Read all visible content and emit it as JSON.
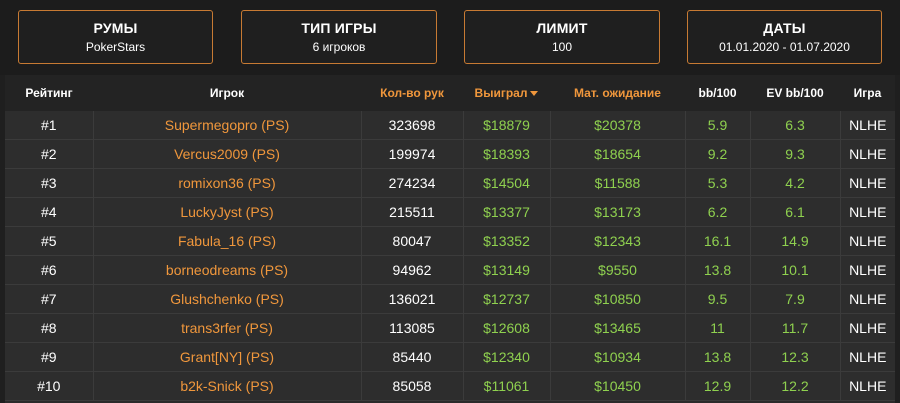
{
  "filters": [
    {
      "title": "РУМЫ",
      "value": "PokerStars"
    },
    {
      "title": "ТИП ИГРЫ",
      "value": "6 игроков"
    },
    {
      "title": "ЛИМИТ",
      "value": "100"
    },
    {
      "title": "ДАТЫ",
      "value": "01.01.2020 - 01.07.2020"
    }
  ],
  "colors": {
    "accent": "#f0973c",
    "positive": "#8fd14f",
    "border": "#c77a33"
  },
  "table": {
    "headers": {
      "rank": "Рейтинг",
      "player": "Игрок",
      "hands": "Кол-во рук",
      "won": "Выиграл",
      "ev": "Мат. ожидание",
      "bb100": "bb/100",
      "evbb100": "EV bb/100",
      "game": "Игра"
    },
    "sort_icon": "caret-down-icon",
    "rows": [
      {
        "rank": "#1",
        "player": "Supermegopro (PS)",
        "hands": "323698",
        "won": "$18879",
        "ev": "$20378",
        "bb100": "5.9",
        "evbb100": "6.3",
        "game": "NLHE"
      },
      {
        "rank": "#2",
        "player": "Vercus2009 (PS)",
        "hands": "199974",
        "won": "$18393",
        "ev": "$18654",
        "bb100": "9.2",
        "evbb100": "9.3",
        "game": "NLHE"
      },
      {
        "rank": "#3",
        "player": "romixon36 (PS)",
        "hands": "274234",
        "won": "$14504",
        "ev": "$11588",
        "bb100": "5.3",
        "evbb100": "4.2",
        "game": "NLHE"
      },
      {
        "rank": "#4",
        "player": "LuckyJyst (PS)",
        "hands": "215511",
        "won": "$13377",
        "ev": "$13173",
        "bb100": "6.2",
        "evbb100": "6.1",
        "game": "NLHE"
      },
      {
        "rank": "#5",
        "player": "Fabula_16 (PS)",
        "hands": "80047",
        "won": "$13352",
        "ev": "$12343",
        "bb100": "16.1",
        "evbb100": "14.9",
        "game": "NLHE"
      },
      {
        "rank": "#6",
        "player": "borneodreams (PS)",
        "hands": "94962",
        "won": "$13149",
        "ev": "$9550",
        "bb100": "13.8",
        "evbb100": "10.1",
        "game": "NLHE"
      },
      {
        "rank": "#7",
        "player": "Glushchenko (PS)",
        "hands": "136021",
        "won": "$12737",
        "ev": "$10850",
        "bb100": "9.5",
        "evbb100": "7.9",
        "game": "NLHE"
      },
      {
        "rank": "#8",
        "player": "trans3rfer (PS)",
        "hands": "113085",
        "won": "$12608",
        "ev": "$13465",
        "bb100": "11",
        "evbb100": "11.7",
        "game": "NLHE"
      },
      {
        "rank": "#9",
        "player": "Grant[NY] (PS)",
        "hands": "85440",
        "won": "$12340",
        "ev": "$10934",
        "bb100": "13.8",
        "evbb100": "12.3",
        "game": "NLHE"
      },
      {
        "rank": "#10",
        "player": "b2k-Snick (PS)",
        "hands": "85058",
        "won": "$11061",
        "ev": "$10450",
        "bb100": "12.9",
        "evbb100": "12.2",
        "game": "NLHE"
      }
    ]
  }
}
